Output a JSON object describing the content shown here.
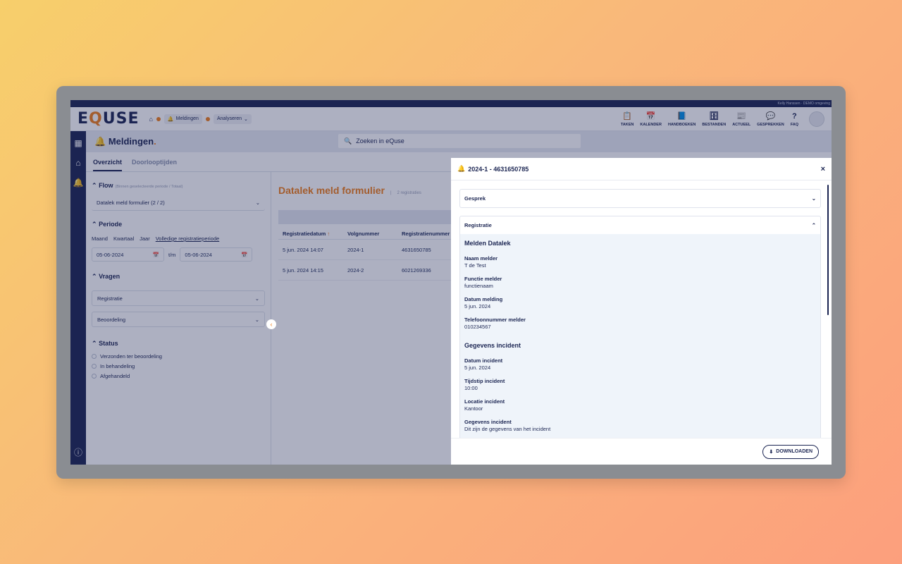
{
  "app": {
    "user_label": "Kelly Hanssen · DEMO omgeving",
    "logo_left": "E",
    "logo_q": "Q",
    "logo_right": "USE"
  },
  "breadcrumb": {
    "items": [
      {
        "label": "Meldingen"
      },
      {
        "label": "Analyseren"
      }
    ]
  },
  "topnav": {
    "items": [
      {
        "icon": "clipboard-icon",
        "glyph": "📋",
        "label": "TAKEN"
      },
      {
        "icon": "calendar-icon",
        "glyph": "📅",
        "label": "KALENDER"
      },
      {
        "icon": "book-icon",
        "glyph": "📘",
        "label": "HANDBOEKEN"
      },
      {
        "icon": "archive-icon",
        "glyph": "🗄",
        "label": "BESTANDEN"
      },
      {
        "icon": "newspaper-icon",
        "glyph": "📰",
        "label": "ACTUEEL"
      },
      {
        "icon": "chat-icon",
        "glyph": "💬",
        "label": "GESPREKKEN"
      },
      {
        "icon": "question-icon",
        "glyph": "?",
        "label": "FAQ"
      }
    ]
  },
  "page": {
    "title": "Meldingen",
    "title_dot": ".",
    "search_placeholder": "Zoeken in eQuse"
  },
  "tabs": [
    {
      "label": "Overzicht"
    },
    {
      "label": "Doorlooptijden"
    }
  ],
  "filters": {
    "flow_label": "Flow",
    "flow_hint": "(Binnen geselecteerde periode / Totaal)",
    "flow_value": "Datalek meld formulier (2 / 2)",
    "periode_label": "Periode",
    "periods": [
      "Maand",
      "Kwartaal",
      "Jaar"
    ],
    "period_full": "Volledige registratieperiode",
    "date_from": "05-06-2024",
    "date_sep": "t/m",
    "date_to": "05-06-2024",
    "vragen_label": "Vragen",
    "vragen_options": [
      "Registratie",
      "Beoordeling"
    ],
    "status_label": "Status",
    "status_options": [
      "Verzonden ter beoordeling",
      "In behandeling",
      "Afgehandeld"
    ]
  },
  "main": {
    "title": "Datalek meld formulier",
    "count": "2 registraties",
    "columns": [
      "Registratiedatum",
      "Volgnummer",
      "Registratienummer"
    ],
    "rows": [
      [
        "5 jun. 2024 14:07",
        "2024-1",
        "4631650785"
      ],
      [
        "5 jun. 2024 14:15",
        "2024-2",
        "6021269336"
      ]
    ]
  },
  "modal": {
    "title": "2024-1 - 4631650785",
    "close": "×",
    "accordion_gesprek": "Gesprek",
    "accordion_registratie": "Registratie",
    "section1": "Melden Datalek",
    "section1_fields": [
      {
        "label": "Naam melder",
        "value": "T de Test"
      },
      {
        "label": "Functie melder",
        "value": "functienaam"
      },
      {
        "label": "Datum melding",
        "value": "5 jun. 2024"
      },
      {
        "label": "Telefoonnummer melder",
        "value": "010234567"
      }
    ],
    "section2": "Gegevens incident",
    "section2_fields": [
      {
        "label": "Datum incident",
        "value": "5 jun. 2024"
      },
      {
        "label": "Tijdstip incident",
        "value": "10:00"
      },
      {
        "label": "Locatie incident",
        "value": "Kantoor"
      },
      {
        "label": "Gegevens incident",
        "value": "Dit zijn de gegevens van het incident"
      }
    ],
    "download_label": "DOWNLOADEN"
  },
  "colors": {
    "navy": "#1b2552",
    "orange": "#f07d1a"
  }
}
